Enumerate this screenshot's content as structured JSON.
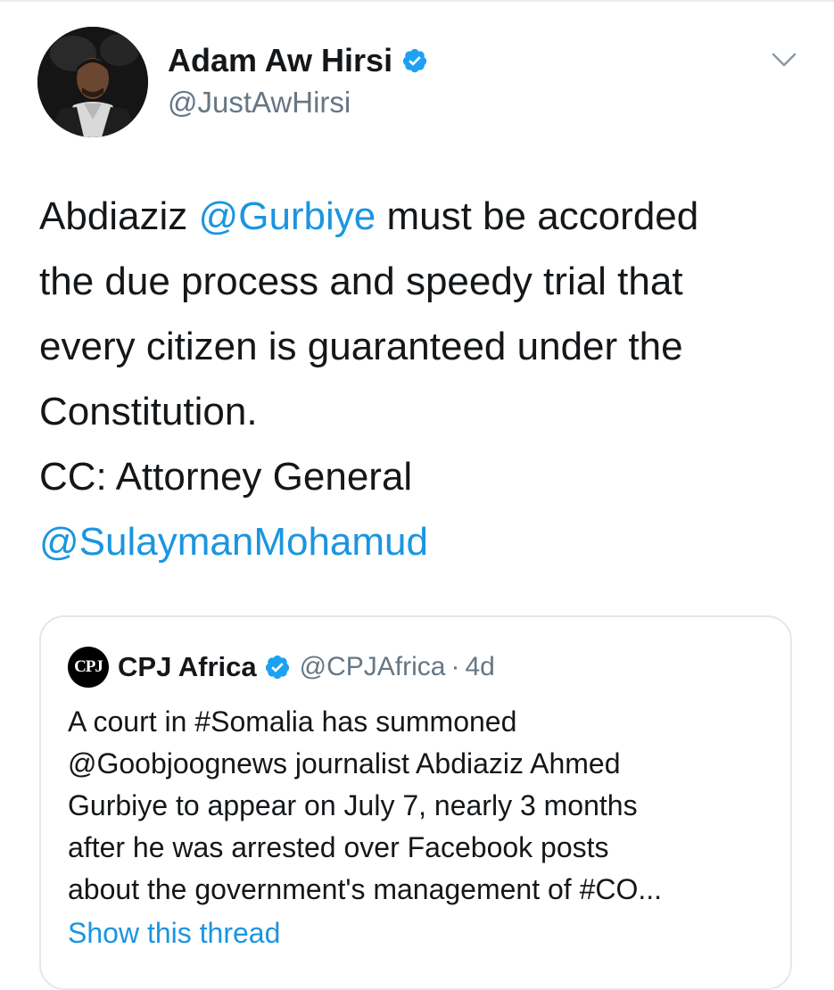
{
  "tweet": {
    "author": {
      "name": "Adam Aw Hirsi",
      "handle": "@JustAwHirsi",
      "verified_icon": "verified-badge-icon"
    },
    "menu_icon": "chevron-down-icon",
    "text_lines": [
      [
        {
          "t": "Abdiaziz ",
          "mention": false
        },
        {
          "t": "@Gurbiye",
          "mention": true
        },
        {
          "t": " must be accorded",
          "mention": false
        }
      ],
      [
        {
          "t": "the due process and speedy trial that",
          "mention": false
        }
      ],
      [
        {
          "t": "every citizen is guaranteed under the",
          "mention": false
        }
      ],
      [
        {
          "t": "Constitution.",
          "mention": false
        }
      ],
      [
        {
          "t": "CC: Attorney General",
          "mention": false
        }
      ],
      [
        {
          "t": "@SulaymanMohamud",
          "mention": true
        }
      ]
    ]
  },
  "quoted_tweet": {
    "avatar_text": "CPJ",
    "name": "CPJ Africa",
    "handle": "@CPJAfrica",
    "separator": "·",
    "time": "4d",
    "text_lines": [
      "A court in #Somalia has summoned",
      "@Goobjoognews journalist Abdiaziz Ahmed",
      "Gurbiye to appear on July 7, nearly 3 months",
      "after he was arrested over Facebook posts",
      "about the government's management of #CO..."
    ],
    "show_thread": "Show this thread"
  },
  "colors": {
    "link": "#1b95e0",
    "secondary_text": "#657786",
    "primary_text": "#14171a",
    "border": "#e1e8ed",
    "verified": "#1da1f2"
  }
}
